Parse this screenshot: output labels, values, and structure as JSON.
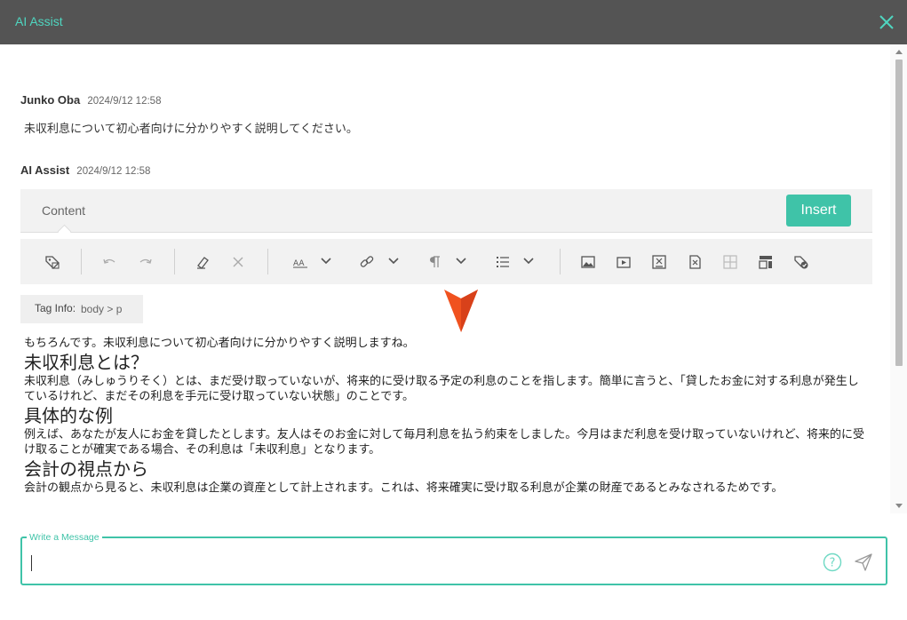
{
  "window": {
    "title": "AI Assist"
  },
  "user_message": {
    "author": "Junko Oba",
    "timestamp": "2024/9/12 12:58",
    "text": "未収利息について初心者向けに分かりやすく説明してください。"
  },
  "assistant_message": {
    "author": "AI Assist",
    "timestamp": "2024/9/12 12:58"
  },
  "editor": {
    "tab_label": "Content",
    "insert_label": "Insert",
    "tag_info_label": "Tag Info:",
    "tag_info_path": "body  >  p",
    "toolbar_icons": [
      "tag-icon",
      "undo-icon",
      "redo-icon",
      "eraser-icon",
      "clear-icon",
      "font-size-icon",
      "link-icon",
      "paragraph-icon",
      "list-icon",
      "image-icon",
      "video-icon",
      "table-icon",
      "table-cut-icon",
      "grid-icon",
      "template-icon",
      "tag-check-icon"
    ],
    "content": {
      "intro": "もちろんです。未収利息について初心者向けに分かりやすく説明しますね。",
      "h1": "未収利息とは？",
      "p1": "未収利息（みしゅうりそく）とは、まだ受け取っていないが、将来的に受け取る予定の利息のことを指します。簡単に言うと、「貸したお金に対する利息が発生しているけれど、まだその利息を手元に受け取っていない状態」のことです。",
      "h2": "具体的な例",
      "p2": "例えば、あなたが友人にお金を貸したとします。友人はそのお金に対して毎月利息を払う約束をしました。今月はまだ利息を受け取っていないけれど、将来的に受け取ることが確実である場合、その利息は「未収利息」となります。",
      "h3": "会計の視点から",
      "p3": "会計の観点から見ると、未収利息は企業の資産として計上されます。これは、将来確実に受け取る利息が企業の財産であるとみなされるためです。"
    }
  },
  "composer": {
    "label": "Write a Message",
    "value": ""
  },
  "colors": {
    "accent": "#3fc3a8",
    "titlebar": "#545454",
    "marker": "#f0521f"
  }
}
